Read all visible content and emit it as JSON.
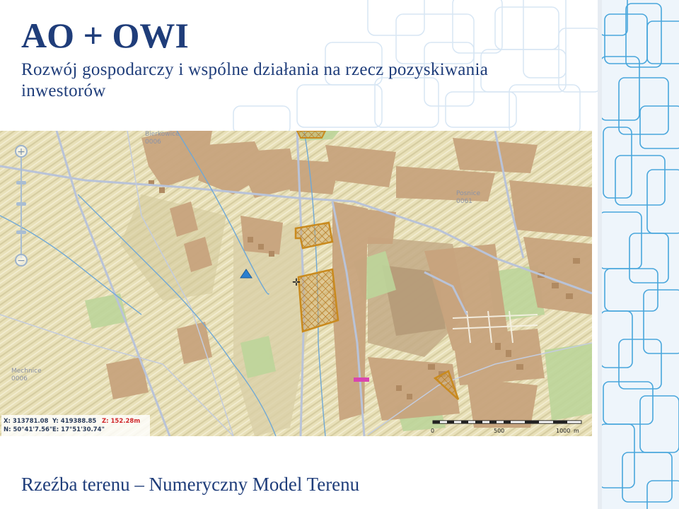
{
  "slide": {
    "title": "AO + OWI",
    "subtitle": "Rozwój gospodarczy i wspólne działania na rzecz pozyskiwania inwestorów",
    "caption": "Rzeźba terenu – Numeryczny Model Terenu"
  },
  "map": {
    "place_labels": [
      {
        "name": "Bierkowice",
        "code": "0006"
      },
      {
        "name": "Posnice",
        "code": "0061"
      },
      {
        "name": "Mechnice",
        "code": "0006"
      }
    ],
    "zoom": {
      "in_symbol": "+",
      "out_symbol": "−"
    },
    "coordinates": {
      "x": "X: 313781.08",
      "y": "Y: 419388.85",
      "z": "Z: 152.28m",
      "n": "N: 50°41'7.56\"",
      "e": "E: 17°51'30.74\""
    },
    "scale": {
      "labels": [
        "0",
        "500",
        "1000",
        "m"
      ]
    },
    "colors": {
      "terrain": "#ede6c2",
      "built_up": "#c8a47e",
      "vegetation": "#bcd59a",
      "hatched_parcel": "#c98a1e",
      "magenta_parcel": "#d946b0",
      "roads": "#b9c3d8",
      "streams": "#6fa8d6"
    }
  }
}
